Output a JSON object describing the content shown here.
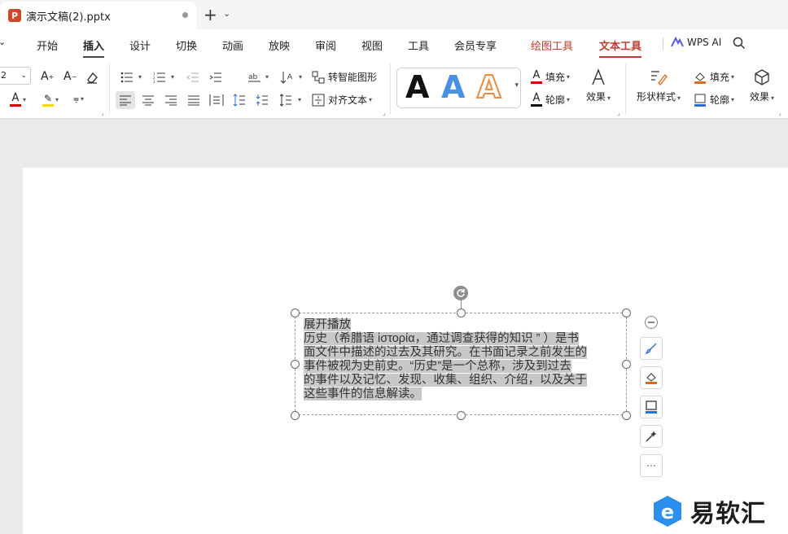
{
  "tab": {
    "title": "演示文稿(2).pptx",
    "logo": "P"
  },
  "menu": {
    "items": [
      "开始",
      "插入",
      "设计",
      "切换",
      "动画",
      "放映",
      "审阅",
      "视图",
      "工具",
      "会员专享"
    ],
    "draw_tools": "绘图工具",
    "text_tools": "文本工具",
    "wps_ai": "WPS AI"
  },
  "ribbon": {
    "font_size": "2",
    "smart_shape": "转智能图形",
    "align_text": "对齐文本",
    "wordart_letter": "A",
    "fill_label": "填充",
    "outline_label": "轮廓",
    "effect_label": "效果",
    "shape_style_label": "形状样式",
    "shape_fill_label": "填充",
    "shape_outline_label": "轮廓",
    "shape_effect_label": "效果"
  },
  "textbox": {
    "lines": [
      "展开播放",
      "历史（希腊语 ἱστορία，通过调查获得的知识 ” ）是书",
      "面文件中描述的过去及其研究。在书面记录之前发生的",
      "事件被视为史前史。“历史”是一个总称，涉及到过去",
      "的事件以及记忆、发现、收集、组织、介绍，以及关于",
      "这些事件的信息解读。"
    ]
  },
  "watermark": {
    "text": "易软汇"
  },
  "colors": {
    "accent_red": "#c0392b",
    "wordart_blue": "#4a90e2",
    "wordart_orange": "#f08a3c",
    "ppt_logo": "#d24726"
  }
}
